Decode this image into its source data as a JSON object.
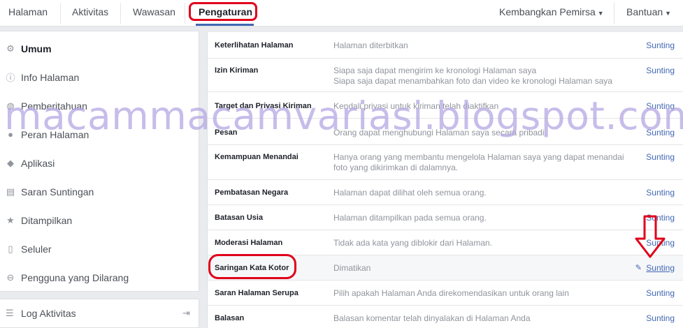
{
  "nav": {
    "tabs": [
      "Halaman",
      "Aktivitas",
      "Wawasan",
      "Pengaturan"
    ],
    "active_tab": "Pengaturan",
    "right": [
      "Kembangkan Pemirsa",
      "Bantuan"
    ]
  },
  "sidebar": {
    "items": [
      {
        "label": "Umum",
        "icon": "gear-icon"
      },
      {
        "label": "Info Halaman",
        "icon": "info-icon"
      },
      {
        "label": "Pemberitahuan",
        "icon": "globe-icon"
      },
      {
        "label": "Peran Halaman",
        "icon": "person-icon"
      },
      {
        "label": "Aplikasi",
        "icon": "cube-icon"
      },
      {
        "label": "Saran Suntingan",
        "icon": "store-icon"
      },
      {
        "label": "Ditampilkan",
        "icon": "star-icon"
      },
      {
        "label": "Seluler",
        "icon": "phone-icon"
      },
      {
        "label": "Pengguna yang Dilarang",
        "icon": "ban-icon"
      }
    ],
    "log": {
      "label": "Log Aktivitas",
      "icon": "list-icon"
    }
  },
  "settings": {
    "edit_label": "Sunting",
    "rows": [
      {
        "label": "Keterlihatan Halaman",
        "value": "Halaman diterbitkan"
      },
      {
        "label": "Izin Kiriman",
        "value": "Siapa saja dapat mengirim ke kronologi Halaman saya",
        "value2": "Siapa saja dapat menambahkan foto dan video ke kronologi Halaman saya"
      },
      {
        "label": "Target dan Privasi Kiriman",
        "value": "Kendali privasi untuk kiriman telah diaktifkan"
      },
      {
        "label": "Pesan",
        "value": "Orang dapat menghubungi Halaman saya secara pribadi."
      },
      {
        "label": "Kemampuan Menandai",
        "value": "Hanya orang yang membantu mengelola Halaman saya yang dapat menandai",
        "value2": "foto yang dikirimkan di dalamnya."
      },
      {
        "label": "Pembatasan Negara",
        "value": "Halaman dapat dilihat oleh semua orang."
      },
      {
        "label": "Batasan Usia",
        "value": "Halaman ditampilkan pada semua orang."
      },
      {
        "label": "Moderasi Halaman",
        "value": "Tidak ada kata yang diblokir dari Halaman."
      },
      {
        "label": "Saringan Kata Kotor",
        "value": "Dimatikan"
      },
      {
        "label": "Saran Halaman Serupa",
        "value": "Pilih apakah Halaman Anda direkomendasikan untuk orang lain"
      },
      {
        "label": "Balasan",
        "value": "Balasan komentar telah dinyalakan di Halaman Anda"
      }
    ]
  },
  "watermark": "macammacamvariasi.blogspot.com",
  "colors": {
    "accent": "#4267b2",
    "highlight_circle": "#e0001a",
    "watermark": "#b5a7e3"
  }
}
